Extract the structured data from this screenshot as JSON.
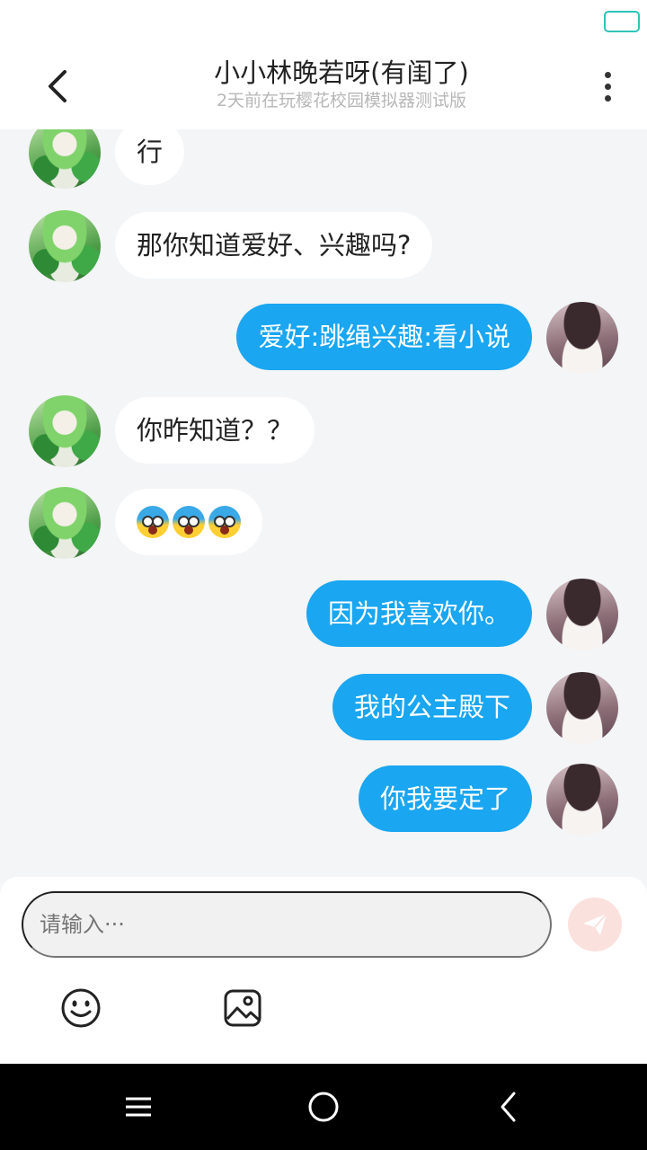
{
  "header": {
    "title": "小小林晚若呀(有闺了)",
    "subtitle": "2天前在玩樱花校园模拟器测试版",
    "back_icon": "chevron-left-icon",
    "more_icon": "more-vertical-icon"
  },
  "messages": [
    {
      "side": "in",
      "text": "行"
    },
    {
      "side": "in",
      "text": "那你知道爱好、兴趣吗?"
    },
    {
      "side": "out",
      "text": "爱好:跳绳兴趣:看小说"
    },
    {
      "side": "in",
      "text": "你昨知道？？"
    },
    {
      "side": "in",
      "emoji": [
        "fearful-face-emoji",
        "fearful-face-emoji",
        "fearful-face-emoji"
      ]
    },
    {
      "side": "out",
      "text": "因为我喜欢你。"
    },
    {
      "side": "out",
      "text": "我的公主殿下"
    },
    {
      "side": "out",
      "text": "你我要定了"
    }
  ],
  "composer": {
    "placeholder": "请输入···",
    "send_icon": "paper-plane-icon",
    "emoji_icon": "smiley-icon",
    "image_icon": "image-icon"
  },
  "colors": {
    "accent": "#1aa6f0",
    "battery": "#2ec4b6",
    "send_bg": "#fbe1dd",
    "background": "#f3f5f7"
  }
}
